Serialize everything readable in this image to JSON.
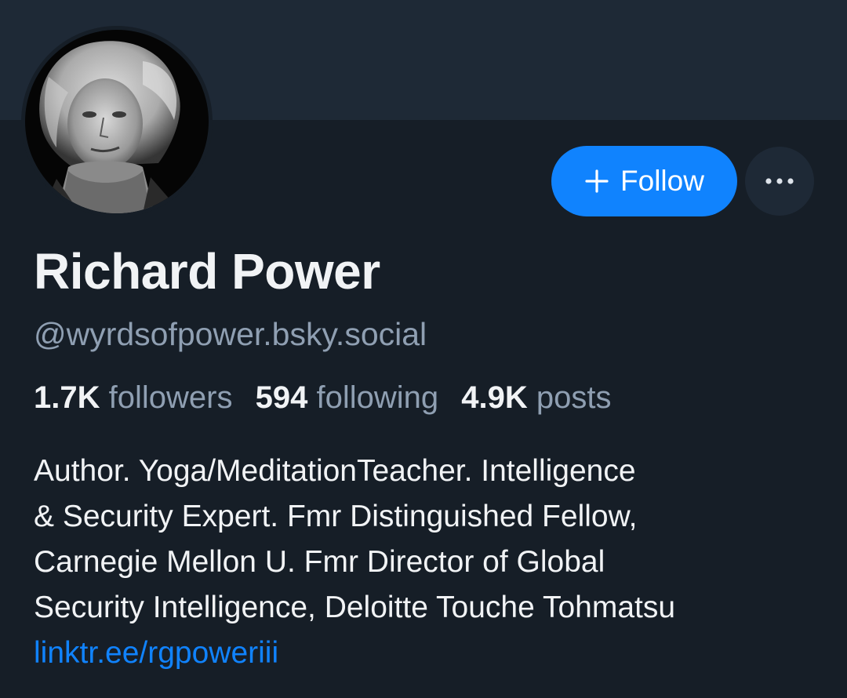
{
  "profile": {
    "display_name": "Richard Power",
    "handle": "@wyrdsofpower.bsky.social",
    "avatar_alt": "profile photo"
  },
  "actions": {
    "follow_label": "Follow",
    "more_label": "•••"
  },
  "stats": {
    "followers_count": "1.7K",
    "followers_label": "followers",
    "following_count": "594",
    "following_label": "following",
    "posts_count": "4.9K",
    "posts_label": "posts"
  },
  "bio": {
    "lines": [
      "Author. Yoga/MeditationTeacher. Intelligence",
      "& Security Expert. Fmr Distinguished Fellow,",
      "Carnegie Mellon U. Fmr Director of Global",
      "Security Intelligence, Deloitte Touche Tohmatsu"
    ],
    "link": "linktr.ee/rgpoweriii"
  },
  "colors": {
    "background": "#161e27",
    "banner": "#1e2936",
    "accent": "#1083fe",
    "text_primary": "#f1f3f5",
    "text_secondary": "#8f9fb2"
  }
}
